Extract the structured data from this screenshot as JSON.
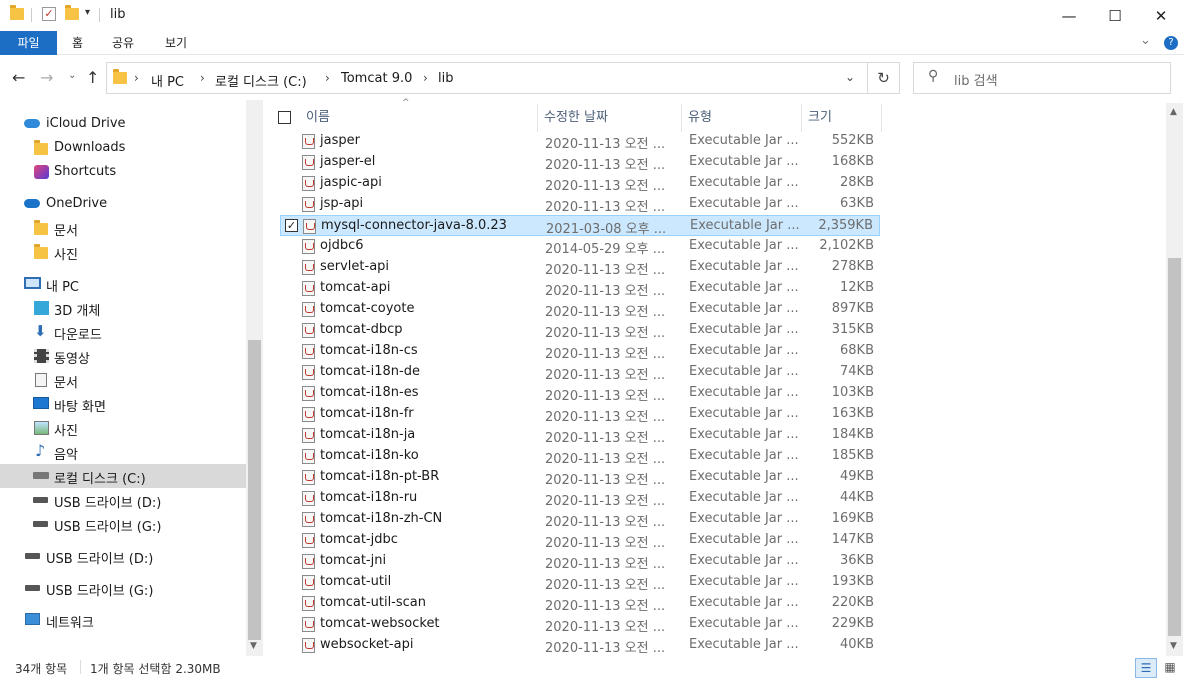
{
  "titlebar": {
    "title": "lib",
    "minimize": "—",
    "maximize": "☐",
    "close": "✕"
  },
  "ribbon": {
    "tabs": [
      "파일",
      "홈",
      "공유",
      "보기"
    ],
    "expand": "⌄",
    "help": "?"
  },
  "address": {
    "crumbs": [
      "내 PC",
      "로컬 디스크 (C:)",
      "Tomcat 9.0",
      "lib"
    ],
    "search_placeholder": "lib 검색"
  },
  "nav": {
    "items": [
      {
        "label": "iCloud Drive",
        "icon": "cloud-icon"
      },
      {
        "label": "Downloads",
        "icon": "folder-icon"
      },
      {
        "label": "Shortcuts",
        "icon": "shortcuts-icon"
      },
      {
        "label": "OneDrive",
        "icon": "cloud-icon"
      },
      {
        "label": "문서",
        "icon": "folder-icon"
      },
      {
        "label": "사진",
        "icon": "folder-icon"
      },
      {
        "label": "내 PC",
        "icon": "pc-icon"
      },
      {
        "label": "3D 개체",
        "icon": "cube-icon"
      },
      {
        "label": "다운로드",
        "icon": "download-icon"
      },
      {
        "label": "동영상",
        "icon": "video-icon"
      },
      {
        "label": "문서",
        "icon": "document-icon"
      },
      {
        "label": "바탕 화면",
        "icon": "desktop-icon"
      },
      {
        "label": "사진",
        "icon": "picture-icon"
      },
      {
        "label": "음악",
        "icon": "music-icon"
      },
      {
        "label": "로컬 디스크 (C:)",
        "icon": "drive-icon"
      },
      {
        "label": "USB 드라이브 (D:)",
        "icon": "usb-drive-icon"
      },
      {
        "label": "USB 드라이브 (G:)",
        "icon": "usb-drive-icon"
      },
      {
        "label": "USB 드라이브 (D:)",
        "icon": "usb-drive-icon"
      },
      {
        "label": "USB 드라이브 (G:)",
        "icon": "usb-drive-icon"
      },
      {
        "label": "네트워크",
        "icon": "network-icon"
      }
    ]
  },
  "list": {
    "columns": [
      "이름",
      "수정한 날짜",
      "유형",
      "크기"
    ],
    "rows": [
      {
        "name": "jasper",
        "date": "2020-11-13 오전 ...",
        "type": "Executable Jar ...",
        "size": "552KB"
      },
      {
        "name": "jasper-el",
        "date": "2020-11-13 오전 ...",
        "type": "Executable Jar ...",
        "size": "168KB"
      },
      {
        "name": "jaspic-api",
        "date": "2020-11-13 오전 ...",
        "type": "Executable Jar ...",
        "size": "28KB"
      },
      {
        "name": "jsp-api",
        "date": "2020-11-13 오전 ...",
        "type": "Executable Jar ...",
        "size": "63KB"
      },
      {
        "name": "mysql-connector-java-8.0.23",
        "date": "2021-03-08 오후 ...",
        "type": "Executable Jar ...",
        "size": "2,359KB",
        "selected": true
      },
      {
        "name": "ojdbc6",
        "date": "2014-05-29 오후 ...",
        "type": "Executable Jar ...",
        "size": "2,102KB"
      },
      {
        "name": "servlet-api",
        "date": "2020-11-13 오전 ...",
        "type": "Executable Jar ...",
        "size": "278KB"
      },
      {
        "name": "tomcat-api",
        "date": "2020-11-13 오전 ...",
        "type": "Executable Jar ...",
        "size": "12KB"
      },
      {
        "name": "tomcat-coyote",
        "date": "2020-11-13 오전 ...",
        "type": "Executable Jar ...",
        "size": "897KB"
      },
      {
        "name": "tomcat-dbcp",
        "date": "2020-11-13 오전 ...",
        "type": "Executable Jar ...",
        "size": "315KB"
      },
      {
        "name": "tomcat-i18n-cs",
        "date": "2020-11-13 오전 ...",
        "type": "Executable Jar ...",
        "size": "68KB"
      },
      {
        "name": "tomcat-i18n-de",
        "date": "2020-11-13 오전 ...",
        "type": "Executable Jar ...",
        "size": "74KB"
      },
      {
        "name": "tomcat-i18n-es",
        "date": "2020-11-13 오전 ...",
        "type": "Executable Jar ...",
        "size": "103KB"
      },
      {
        "name": "tomcat-i18n-fr",
        "date": "2020-11-13 오전 ...",
        "type": "Executable Jar ...",
        "size": "163KB"
      },
      {
        "name": "tomcat-i18n-ja",
        "date": "2020-11-13 오전 ...",
        "type": "Executable Jar ...",
        "size": "184KB"
      },
      {
        "name": "tomcat-i18n-ko",
        "date": "2020-11-13 오전 ...",
        "type": "Executable Jar ...",
        "size": "185KB"
      },
      {
        "name": "tomcat-i18n-pt-BR",
        "date": "2020-11-13 오전 ...",
        "type": "Executable Jar ...",
        "size": "49KB"
      },
      {
        "name": "tomcat-i18n-ru",
        "date": "2020-11-13 오전 ...",
        "type": "Executable Jar ...",
        "size": "44KB"
      },
      {
        "name": "tomcat-i18n-zh-CN",
        "date": "2020-11-13 오전 ...",
        "type": "Executable Jar ...",
        "size": "169KB"
      },
      {
        "name": "tomcat-jdbc",
        "date": "2020-11-13 오전 ...",
        "type": "Executable Jar ...",
        "size": "147KB"
      },
      {
        "name": "tomcat-jni",
        "date": "2020-11-13 오전 ...",
        "type": "Executable Jar ...",
        "size": "36KB"
      },
      {
        "name": "tomcat-util",
        "date": "2020-11-13 오전 ...",
        "type": "Executable Jar ...",
        "size": "193KB"
      },
      {
        "name": "tomcat-util-scan",
        "date": "2020-11-13 오전 ...",
        "type": "Executable Jar ...",
        "size": "220KB"
      },
      {
        "name": "tomcat-websocket",
        "date": "2020-11-13 오전 ...",
        "type": "Executable Jar ...",
        "size": "229KB"
      },
      {
        "name": "websocket-api",
        "date": "2020-11-13 오전 ...",
        "type": "Executable Jar ...",
        "size": "40KB"
      }
    ]
  },
  "status": {
    "count": "34개 항목",
    "selection": "1개 항목 선택함 2.30MB"
  },
  "colors": {
    "accent": "#1c6ec4",
    "selection_bg": "#cce8ff",
    "selection_border": "#99d1ff",
    "nav_selected": "#d9d9d9"
  }
}
